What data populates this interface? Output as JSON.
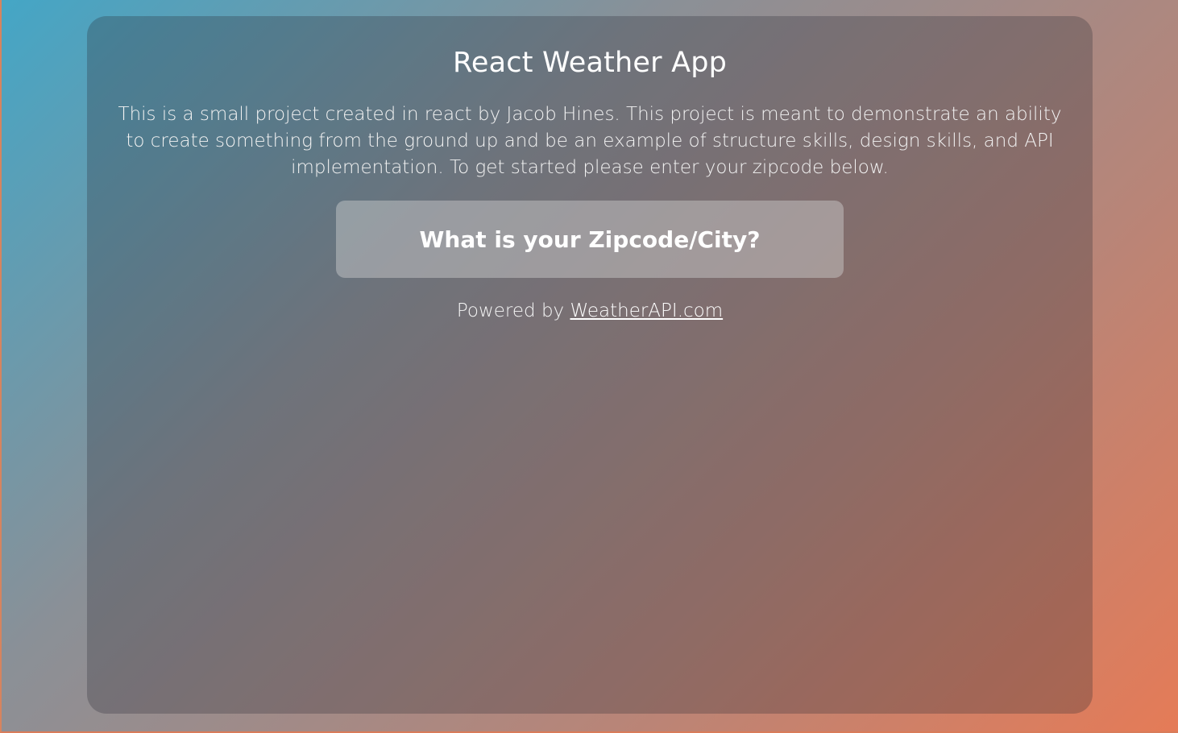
{
  "app": {
    "title": "React Weather App",
    "description": "This is a small project created in react by Jacob Hines. This project is meant to demonstrate an ability to create something from the ground up and be an example of structure skills, design skills, and API implementation. To get started please enter your zipcode below."
  },
  "search": {
    "placeholder": "What is your Zipcode/City?",
    "value": ""
  },
  "footer": {
    "powered_prefix": "Powered by ",
    "link_label": "WeatherAPI.com"
  },
  "colors": {
    "gradient_start": "#44a6c6",
    "gradient_end": "#e57b57",
    "text": "#ffffff"
  }
}
